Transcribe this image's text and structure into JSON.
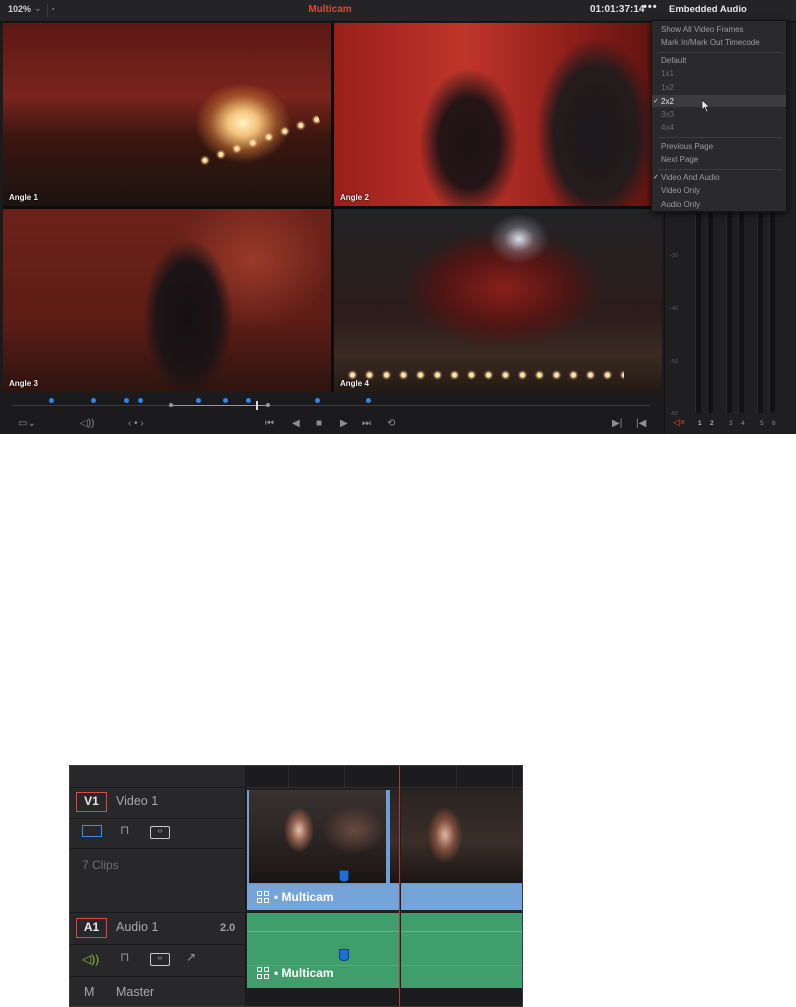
{
  "viewer": {
    "zoom": "102%",
    "title": "Multicam",
    "timecode": "01:01:37:14",
    "more_button": "•••",
    "audio_panel_label": "Embedded Audio",
    "angles": [
      {
        "label": "Angle 1"
      },
      {
        "label": "Angle 2"
      },
      {
        "label": "Angle 3"
      },
      {
        "label": "Angle 4"
      }
    ],
    "accent_color": "#e0463c",
    "marker_color": "#2f86e6"
  },
  "menu": {
    "items": [
      {
        "label": "Show All Video Frames"
      },
      {
        "label": "Mark In/Mark Out Timecode"
      },
      {
        "label": "Default"
      },
      {
        "label": "1x1"
      },
      {
        "label": "1x2"
      },
      {
        "label": "2x2",
        "checked": true,
        "highlighted": true
      },
      {
        "label": "3x3"
      },
      {
        "label": "4x4"
      },
      {
        "label": "Previous Page"
      },
      {
        "label": "Next Page"
      },
      {
        "label": "Video And Audio",
        "checked": true
      },
      {
        "label": "Video Only"
      },
      {
        "label": "Audio Only"
      }
    ]
  },
  "meters": {
    "ticks": [
      "-30",
      "-40",
      "-50",
      "-60"
    ],
    "channels": [
      "1",
      "2",
      "3",
      "4",
      "5",
      "6"
    ]
  },
  "timeline": {
    "video_track": {
      "id": "V1",
      "name": "Video 1",
      "clips_note": "7 Clips",
      "clip_title": "Multicam"
    },
    "audio_track": {
      "id": "A1",
      "name": "Audio 1",
      "channels": "2.0",
      "clip_title": "Multicam"
    },
    "master_track": {
      "id": "M",
      "name": "Master"
    },
    "video_clip_color": "#6f9fd4",
    "audio_clip_color": "#3f9e6c"
  }
}
